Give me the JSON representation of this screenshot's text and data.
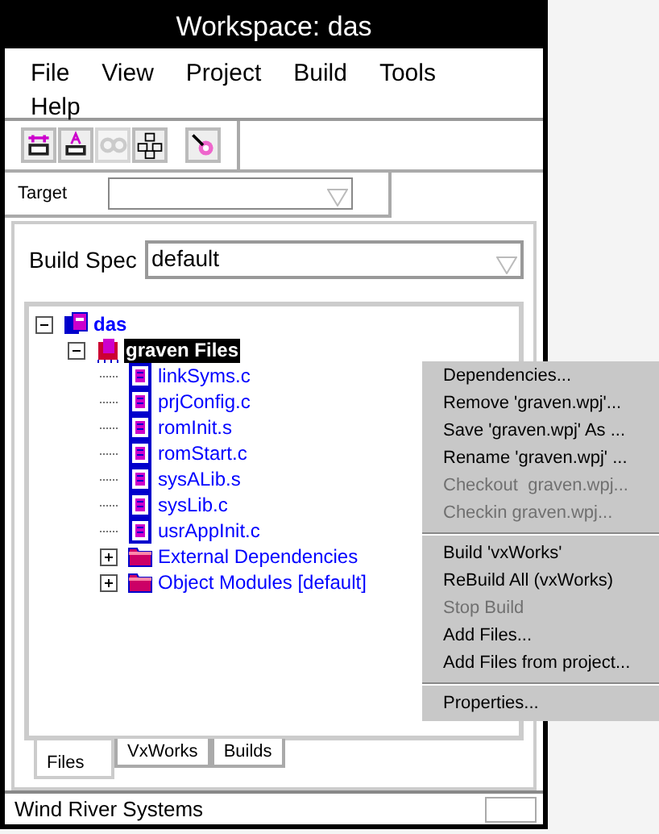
{
  "window": {
    "title": "Workspace: das"
  },
  "menu_bar": [
    "File",
    "View",
    "Project",
    "Build",
    "Tools",
    "Help"
  ],
  "toolbar": [
    {
      "kind": "add"
    },
    {
      "kind": "edit"
    },
    {
      "kind": "cc",
      "disabled": true
    },
    {
      "kind": "tree"
    },
    {
      "kind": "target"
    }
  ],
  "target": {
    "label": "Target"
  },
  "build_spec": {
    "label": "Build Spec",
    "value": "default"
  },
  "tree": [
    {
      "label": "das",
      "kind": "project",
      "expanded": true,
      "selected": false,
      "children": [
        {
          "label": "graven Files",
          "kind": "group",
          "expanded": true,
          "selected": true,
          "children": [
            {
              "label": "linkSyms.c",
              "kind": "file",
              "selected": false
            },
            {
              "label": "prjConfig.c",
              "kind": "file",
              "selected": false
            },
            {
              "label": "romInit.s",
              "kind": "file",
              "selected": false
            },
            {
              "label": "romStart.c",
              "kind": "file",
              "selected": false
            },
            {
              "label": "sysALib.s",
              "kind": "file",
              "selected": false
            },
            {
              "label": "sysLib.c",
              "kind": "file",
              "selected": false
            },
            {
              "label": "usrAppInit.c",
              "kind": "file",
              "selected": false
            },
            {
              "label": "External Dependencies",
              "kind": "folder",
              "expanded": false,
              "selected": false
            },
            {
              "label": "Object Modules [default]",
              "kind": "folder",
              "expanded": false,
              "selected": false
            }
          ]
        }
      ]
    }
  ],
  "tabs": [
    {
      "label": "Files",
      "selected": true
    },
    {
      "label": "VxWorks",
      "selected": false
    },
    {
      "label": "Builds",
      "selected": false
    }
  ],
  "status_bar": {
    "text": "Wind River Systems"
  },
  "context_menu": [
    [
      {
        "label": "Dependencies...",
        "disabled": false
      },
      {
        "label": "Remove 'graven.wpj'...",
        "disabled": false
      },
      {
        "label": "Save 'graven.wpj' As ...",
        "disabled": false
      },
      {
        "label": "Rename 'graven.wpj' ...",
        "disabled": false
      },
      {
        "label": "Checkout  graven.wpj...",
        "disabled": true
      },
      {
        "label": "Checkin graven.wpj...",
        "disabled": true
      }
    ],
    [
      {
        "label": "Build 'vxWorks'",
        "disabled": false
      },
      {
        "label": "ReBuild All (vxWorks)",
        "disabled": false
      },
      {
        "label": "Stop Build",
        "disabled": true
      },
      {
        "label": "Add Files...",
        "disabled": false
      },
      {
        "label": "Add Files from project...",
        "disabled": false
      }
    ],
    [
      {
        "label": "Properties...",
        "disabled": false
      }
    ]
  ]
}
